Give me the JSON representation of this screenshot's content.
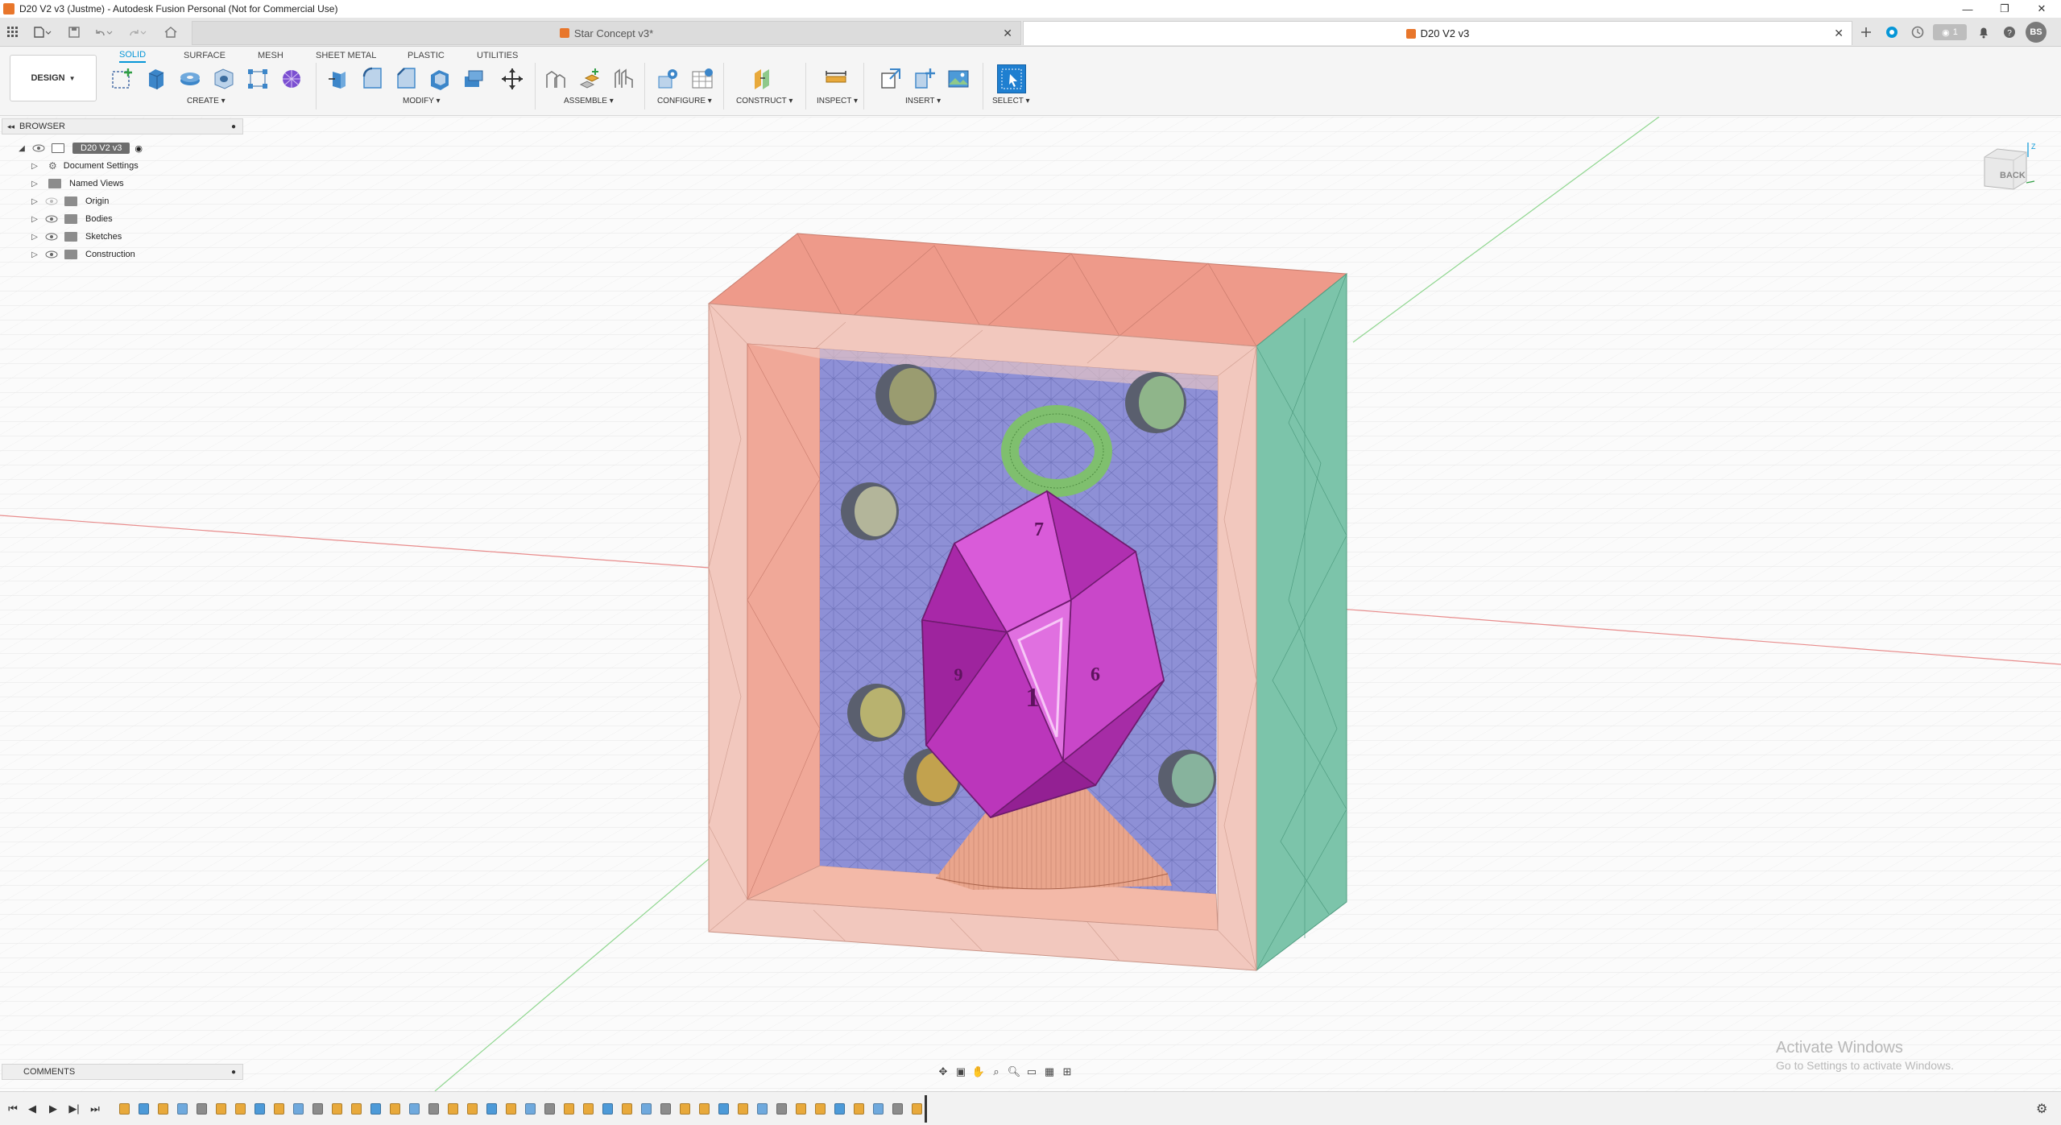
{
  "window": {
    "title": "D20 V2 v3 (Justme) - Autodesk Fusion Personal (Not for Commercial Use)",
    "controls": [
      "—",
      "❐",
      "✕"
    ]
  },
  "tabs": [
    {
      "label": "Star Concept v3*",
      "active": false
    },
    {
      "label": "D20 V2 v3",
      "active": true
    }
  ],
  "account": {
    "initials": "BS",
    "job_count": "1"
  },
  "toolbar": {
    "workspace": "DESIGN",
    "workspace_tabs": [
      "SOLID",
      "SURFACE",
      "MESH",
      "SHEET METAL",
      "PLASTIC",
      "UTILITIES"
    ],
    "active_tab": "SOLID",
    "groups": [
      "CREATE",
      "MODIFY",
      "ASSEMBLE",
      "CONFIGURE",
      "CONSTRUCT",
      "INSPECT",
      "INSERT",
      "SELECT"
    ]
  },
  "browser": {
    "header": "BROWSER",
    "root": "D20 V2 v3",
    "items": [
      {
        "label": "Document Settings",
        "icon": "gear-icon"
      },
      {
        "label": "Named Views",
        "icon": "folder-icon"
      },
      {
        "label": "Origin",
        "icon": "folder-icon"
      },
      {
        "label": "Bodies",
        "icon": "folder-icon"
      },
      {
        "label": "Sketches",
        "icon": "folder-icon"
      },
      {
        "label": "Construction",
        "icon": "folder-icon"
      }
    ]
  },
  "viewcube": {
    "face": "BACK",
    "axis": "Z"
  },
  "comments": {
    "label": "COMMENTS"
  },
  "watermark": {
    "line1": "Activate Windows",
    "line2": "Go to Settings to activate Windows."
  },
  "colors": {
    "accent": "#0696d7",
    "frame_top": "#ee9a8a",
    "frame_front": "#f2c8be",
    "frame_side": "#7cc4aa",
    "back_wall": "#8e90d6",
    "die": "#c43bc4",
    "ring": "#7fbf6e",
    "cone": "#e9a58c"
  }
}
